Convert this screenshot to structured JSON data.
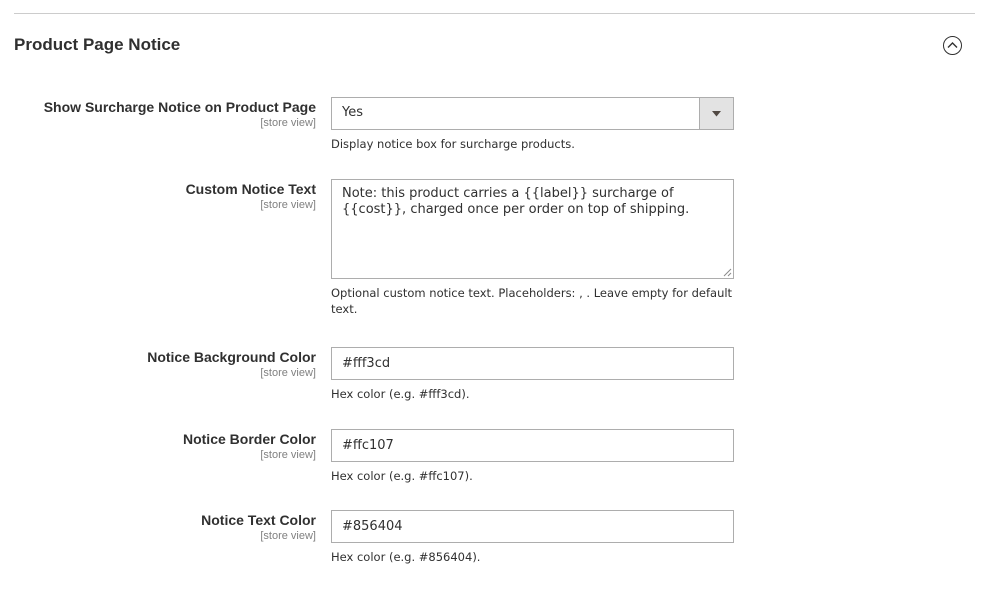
{
  "section": {
    "title": "Product Page Notice",
    "collapse_icon": "chevron-up-circle-icon"
  },
  "fields": {
    "show_notice": {
      "label": "Show Surcharge Notice on Product Page",
      "scope": "[store view]",
      "value": "Yes",
      "note": "Display notice box for surcharge products."
    },
    "custom_text": {
      "label": "Custom Notice Text",
      "scope": "[store view]",
      "value": "Note: this product carries a {{label}} surcharge of {{cost}}, charged once per order on top of shipping.",
      "note": "Optional custom notice text. Placeholders: , . Leave empty for default text."
    },
    "bg_color": {
      "label": "Notice Background Color",
      "scope": "[store view]",
      "value": "#fff3cd",
      "note": "Hex color (e.g. #fff3cd)."
    },
    "border_color": {
      "label": "Notice Border Color",
      "scope": "[store view]",
      "value": "#ffc107",
      "note": "Hex color (e.g. #ffc107)."
    },
    "text_color": {
      "label": "Notice Text Color",
      "scope": "[store view]",
      "value": "#856404",
      "note": "Hex color (e.g. #856404)."
    }
  }
}
